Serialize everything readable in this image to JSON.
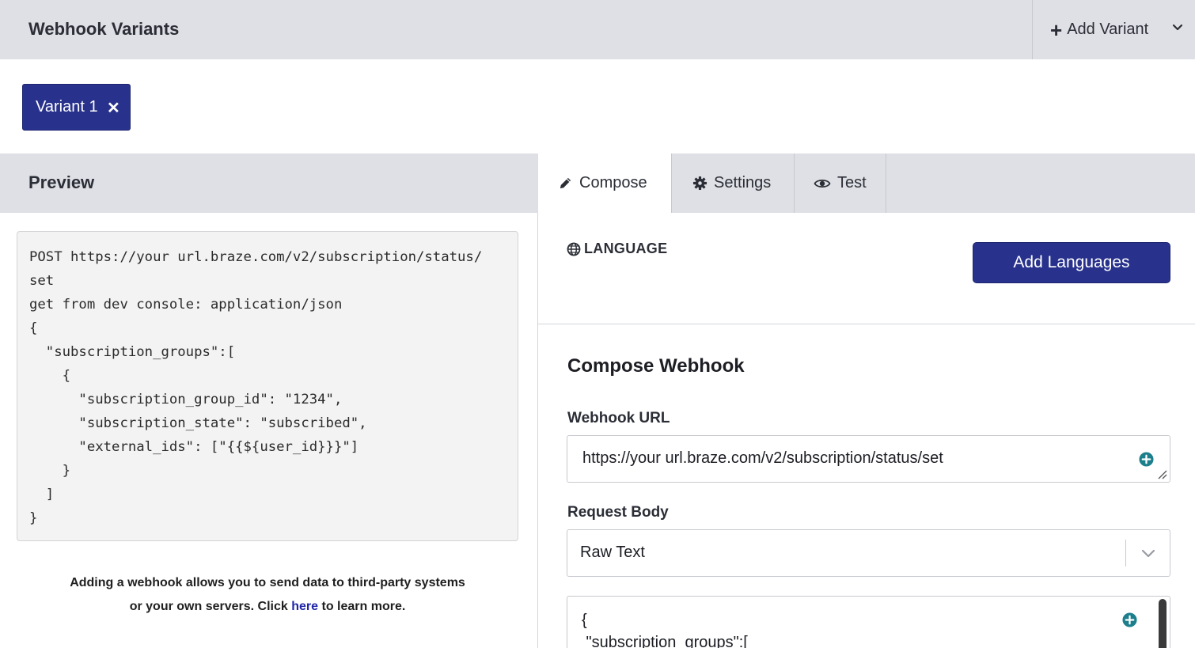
{
  "header": {
    "title": "Webhook Variants",
    "add_variant_label": "Add Variant"
  },
  "variants": {
    "active_label": "Variant 1"
  },
  "preview": {
    "title": "Preview",
    "code": "POST https://your url.braze.com/v2/subscription/status/\nset\nget from dev console: application/json\n{\n  \"subscription_groups\":[\n    {\n      \"subscription_group_id\": \"1234\",\n      \"subscription_state\": \"subscribed\",\n      \"external_ids\": [\"{{${user_id}}}\"]\n    }\n  ]\n}",
    "helper_text_1": "Adding a webhook allows you to send data to third-party systems",
    "helper_text_2": "or your own servers. Click",
    "helper_link": "here",
    "helper_text_3": "to learn more."
  },
  "tabs": [
    {
      "label": "Compose",
      "icon": "pencil-icon",
      "active": true
    },
    {
      "label": "Settings",
      "icon": "gear-icon",
      "active": false
    },
    {
      "label": "Test",
      "icon": "eye-icon",
      "active": false
    }
  ],
  "compose": {
    "language_label": "LANGUAGE",
    "add_languages_label": "Add Languages",
    "section_title": "Compose Webhook",
    "webhook_url_label": "Webhook URL",
    "webhook_url_value": "https://your url.braze.com/v2/subscription/status/set",
    "request_body_label": "Request Body",
    "request_body_selected": "Raw Text",
    "raw_body_text": "{\n \"subscription_groups\":["
  },
  "colors": {
    "primary": "#28328c",
    "header_bg": "#dfe0e5",
    "plus_icon": "#1d7f8c",
    "link": "#2026a8"
  }
}
